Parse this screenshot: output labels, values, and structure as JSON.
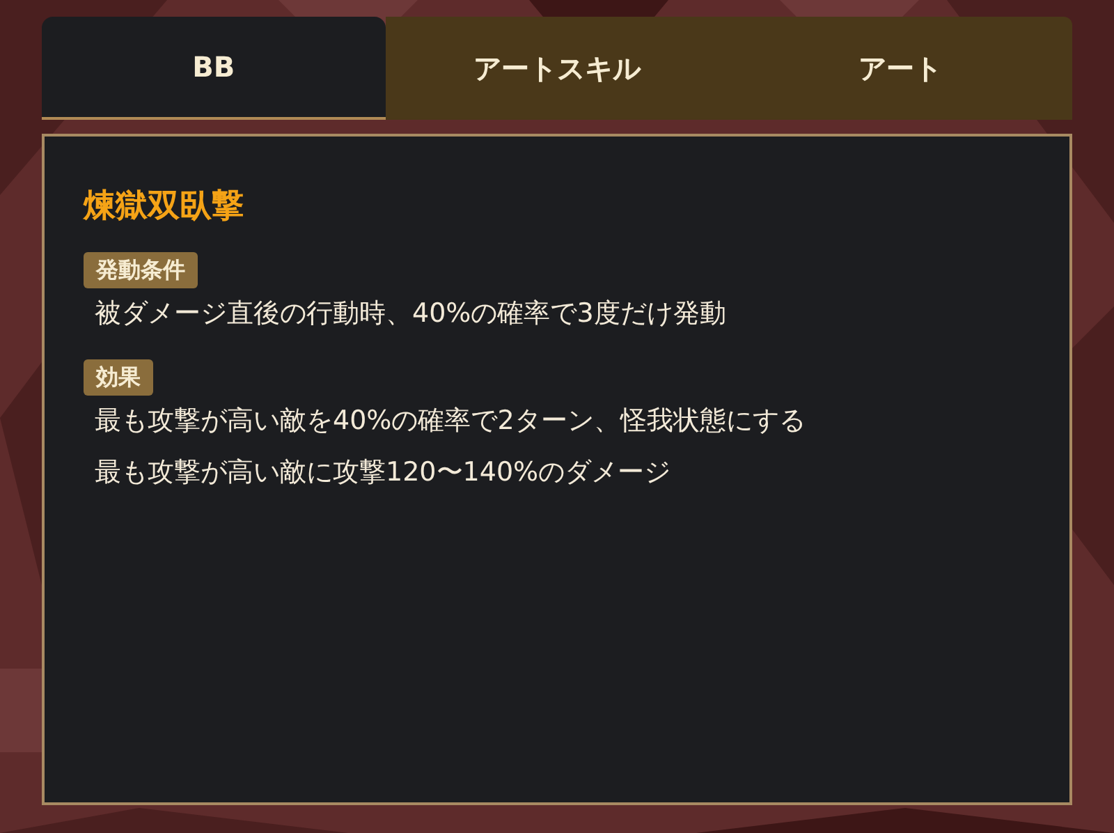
{
  "tabs": [
    {
      "label": "BB",
      "selected": true
    },
    {
      "label": "アートスキル",
      "selected": false
    },
    {
      "label": "アート",
      "selected": false
    }
  ],
  "skill": {
    "name": "煉獄双臥撃",
    "sections": [
      {
        "label": "発動条件",
        "lines": [
          "被ダメージ直後の行動時、40%の確率で3度だけ発動"
        ]
      },
      {
        "label": "効果",
        "lines": [
          "最も攻撃が高い敵を40%の確率で2ターン、怪我状態にする",
          "最も攻撃が高い敵に攻撃120〜140%のダメージ"
        ]
      }
    ]
  }
}
